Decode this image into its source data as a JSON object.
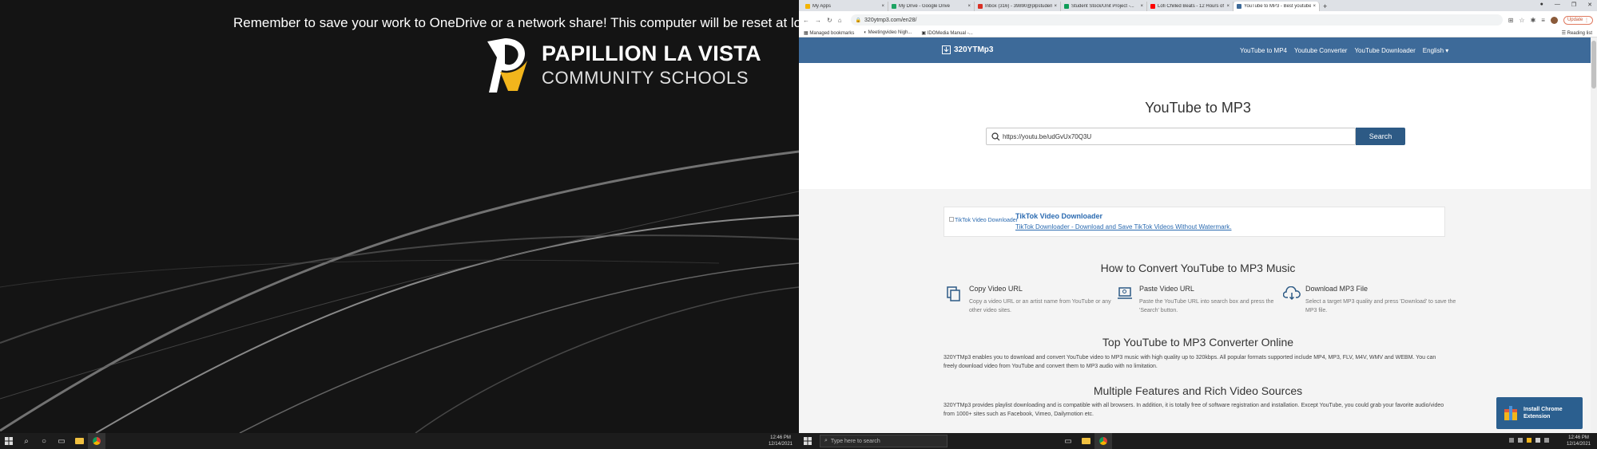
{
  "left_screen": {
    "warning": "Remember to save your work to OneDrive or a network share!  This computer will be reset at log off!",
    "logo": {
      "line1": "PAPILLION LA VISTA",
      "line2": "COMMUNITY SCHOOLS"
    },
    "clock": {
      "time": "12:46 PM",
      "date": "12/14/2021"
    }
  },
  "browser": {
    "tabs": [
      {
        "label": "My Apps",
        "color": "#f4b400"
      },
      {
        "label": "My Drive - Google Drive",
        "color": "#1fa463"
      },
      {
        "label": "Inbox (316) - 39890@plpstudent...",
        "color": "#d93025"
      },
      {
        "label": "Student Stock/Unit Project -...",
        "color": "#0f9d58"
      },
      {
        "label": "Lofi Chilled Beats - 12 Hours of ...",
        "color": "#ff0000"
      },
      {
        "label": "YouTube to MP3 - Best youtube...",
        "color": "#3d6a99",
        "active": true
      }
    ],
    "url": "320ytmp3.com/en28/",
    "update_label": "Update",
    "bookmarks": [
      "Managed bookmarks",
      "Meetingvideo Nigh...",
      "IDOMedia Manual -..."
    ],
    "reading_list": "Reading list"
  },
  "site": {
    "brand": "320YTMp3",
    "nav": [
      "YouTube to MP4",
      "Youtube Converter",
      "YouTube Downloader",
      "English ▾"
    ],
    "title": "YouTube to MP3",
    "search_value": "https://youtu.be/udGvUx70Q3U",
    "search_button": "Search",
    "tiktok": {
      "image_alt": "TikTok Video Downloader",
      "title": "TikTok Video Downloader",
      "desc": "TikTok Downloader - Download and Save TikTok Videos Without Watermark."
    },
    "how_title": "How to Convert YouTube to MP3 Music",
    "steps": [
      {
        "title": "Copy Video URL",
        "desc": "Copy a video URL or an artist name from YouTube or any other video sites."
      },
      {
        "title": "Paste Video URL",
        "desc": "Paste the YouTube URL into search box and press the 'Search' button."
      },
      {
        "title": "Download MP3 File",
        "desc": "Select a target MP3 quality and press 'Download' to save the MP3 file."
      }
    ],
    "top_title": "Top YouTube to MP3 Converter Online",
    "top_desc": "320YTMp3 enables you to download and convert YouTube video to MP3 music with high quality up to 320kbps. All popular formats supported include MP4, MP3, FLV, M4V, WMV and WEBM. You can freely download video from YouTube and convert them to MP3 audio with no limitation.",
    "multi_title": "Multiple Features and Rich Video Sources",
    "multi_desc": "320YTMp3 provides playlist downloading and is compatible with all browsers. In addition, it is totally free of software registration and installation. Except YouTube, you could grab your favorite audio/video from 1000+ sites such as Facebook, Vimeo, Dailymotion etc.",
    "chrome_ext": "Install Chrome Extension"
  },
  "right_taskbar": {
    "search_placeholder": "Type here to search",
    "clock": {
      "time": "12:46 PM",
      "date": "12/14/2021"
    }
  },
  "colors": {
    "header": "#3d6a99",
    "search_button": "#2d5a85",
    "link": "#2a6ab0",
    "logo_gold": "#f2b51c"
  }
}
